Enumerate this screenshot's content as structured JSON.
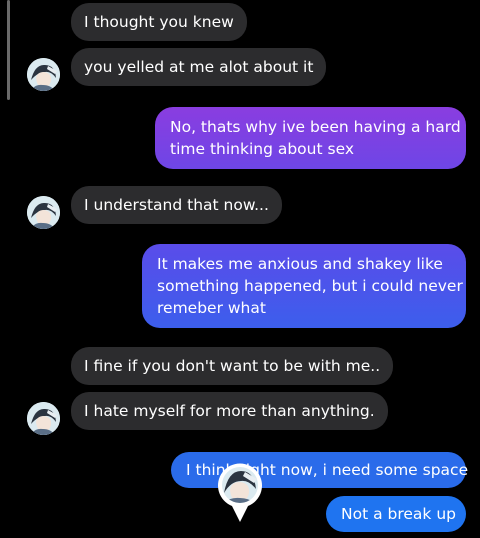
{
  "conversation": {
    "messages": [
      {
        "sender": "them",
        "text": "I thought you knew"
      },
      {
        "sender": "them",
        "text": "you yelled at me alot about it"
      },
      {
        "sender": "me",
        "lines": [
          "No, thats why ive been having a hard",
          "time thinking about sex"
        ]
      },
      {
        "sender": "them",
        "text": "I understand that now..."
      },
      {
        "sender": "me",
        "lines": [
          "It makes me anxious and shakey like",
          "something happened, but i could never",
          "remeber what"
        ]
      },
      {
        "sender": "them",
        "text": "I fine if you don't want to be with me.."
      },
      {
        "sender": "them",
        "text": "I hate myself for more than anything."
      },
      {
        "sender": "me",
        "text": "I think right now, i need some space"
      },
      {
        "sender": "me",
        "text": "Not a break up"
      }
    ]
  },
  "icons": {
    "contact_avatar": "avatar-icon",
    "seen_indicator": "seen-avatar-icon"
  },
  "colors": {
    "background": "#000000",
    "incoming_bubble": "#2c2c2e",
    "outgoing_gradient_purple": "#7a3fe4",
    "outgoing_gradient_blue": "#2f6be8",
    "outgoing_blue": "#1f74f0"
  }
}
